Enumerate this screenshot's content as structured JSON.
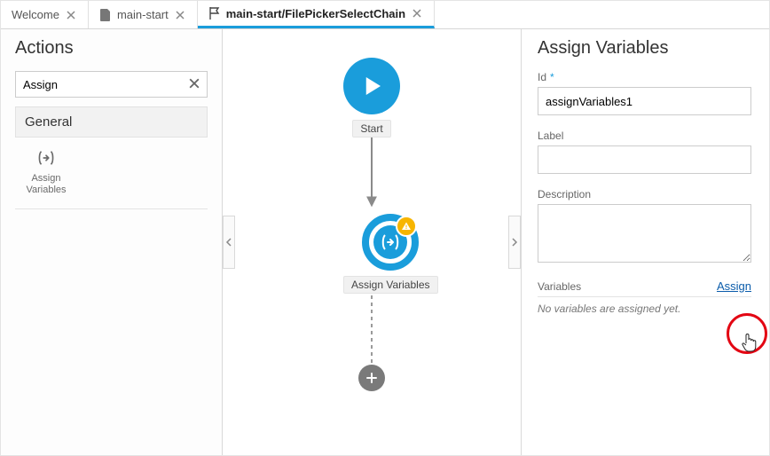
{
  "tabs": [
    {
      "label": "Welcome",
      "icon": null,
      "active": false
    },
    {
      "label": "main-start",
      "icon": "file",
      "active": false
    },
    {
      "label": "main-start/FilePickerSelectChain",
      "icon": "flag",
      "active": true
    }
  ],
  "left": {
    "title": "Actions",
    "search_value": "Assign",
    "group": "General",
    "palette": [
      {
        "icon": "assign",
        "label": "Assign\nVariables"
      }
    ]
  },
  "canvas": {
    "nodes": {
      "start": {
        "label": "Start"
      },
      "assign": {
        "label": "Assign Variables"
      }
    }
  },
  "right": {
    "title": "Assign Variables",
    "id_label": "Id",
    "id_value": "assignVariables1",
    "label_label": "Label",
    "label_value": "",
    "description_label": "Description",
    "description_value": "",
    "variables_label": "Variables",
    "assign_link": "Assign",
    "empty_text": "No variables are assigned yet."
  }
}
